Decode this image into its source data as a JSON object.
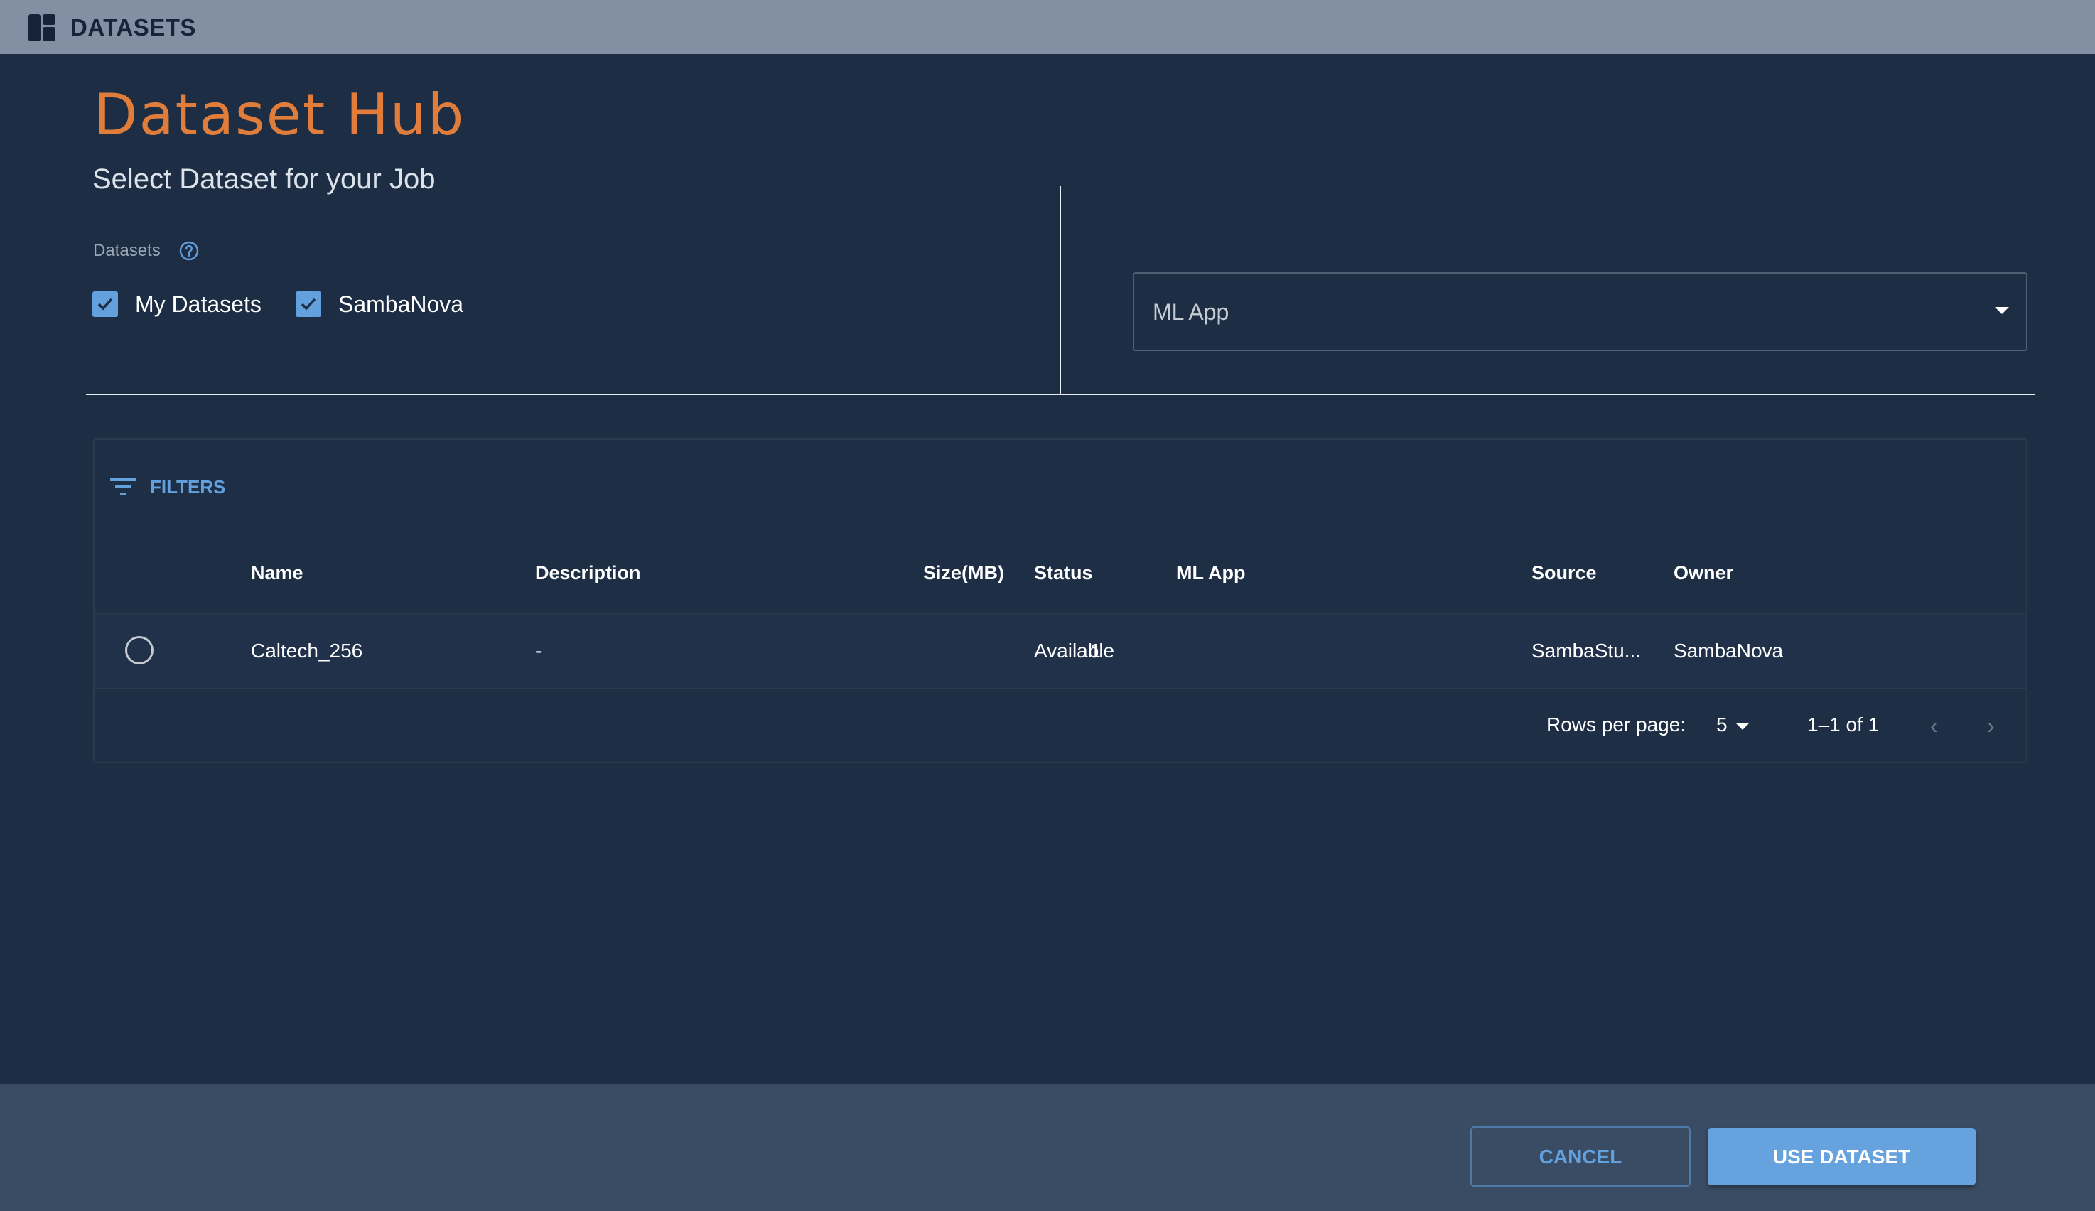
{
  "topbar": {
    "icon": "dashboard-icon",
    "title": "DATASETS"
  },
  "header": {
    "title": "Dataset Hub",
    "subtitle": "Select Dataset for your Job"
  },
  "datasets_filter": {
    "label": "Datasets",
    "help_icon": "help-circle-icon",
    "options": [
      {
        "label": "My Datasets",
        "checked": true
      },
      {
        "label": "SambaNova",
        "checked": true
      }
    ]
  },
  "ml_app_select": {
    "value": "ML App",
    "icon": "caret-down-icon"
  },
  "table": {
    "filters_label": "FILTERS",
    "filters_icon": "filter-icon",
    "columns": [
      "Name",
      "Description",
      "Size(MB)",
      "Status",
      "ML App",
      "Source",
      "Owner"
    ],
    "rows": [
      {
        "selected": false,
        "name": "Caltech_256",
        "description": "-",
        "size_mb": "1",
        "status": "Available",
        "ml_app": "",
        "source": "SambaStu...",
        "owner": "SambaNova"
      }
    ],
    "pagination": {
      "rows_per_page_label": "Rows per page:",
      "rows_per_page_value": "5",
      "range": "1–1 of 1",
      "prev_icon": "chevron-left-icon",
      "next_icon": "chevron-right-icon"
    }
  },
  "footer": {
    "cancel_label": "CANCEL",
    "use_label": "USE DATASET"
  },
  "colors": {
    "accent": "#63a1de",
    "title_orange": "#e07d3a",
    "background": "#1d2d44",
    "topbar": "#8390a3",
    "footer": "#3a4c63"
  }
}
